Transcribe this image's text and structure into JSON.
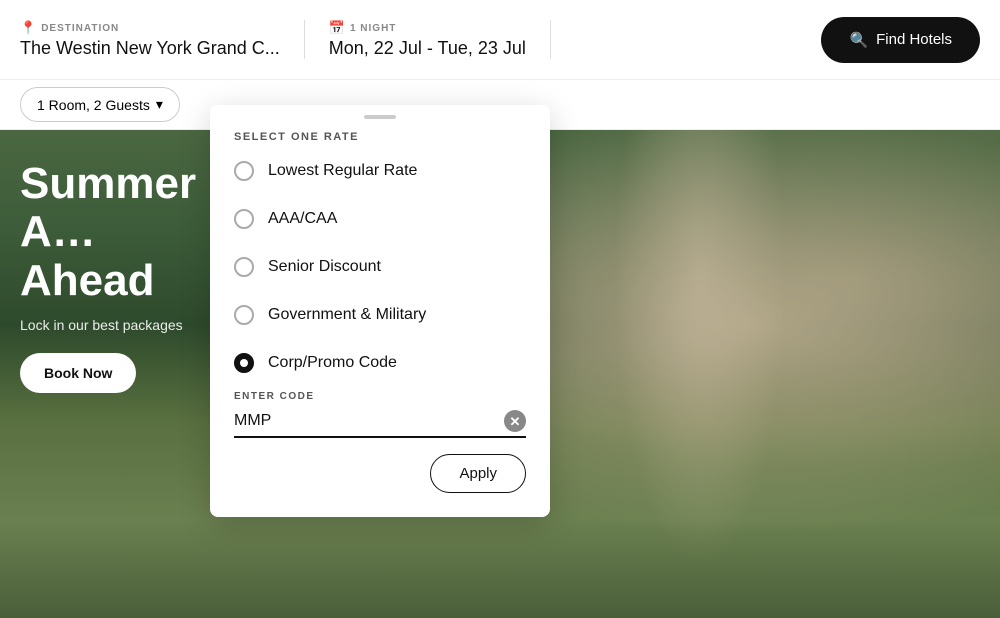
{
  "header": {
    "destination_label": "DESTINATION",
    "destination_value": "The Westin New York Grand C...",
    "nights_label": "1 NIGHT",
    "nights_value": "Mon, 22 Jul - Tue, 23 Jul",
    "find_hotels_label": "Find Hotels"
  },
  "subheader": {
    "rooms_guests_label": "1 Room, 2 Guests"
  },
  "hero": {
    "title": "Summer A… Ahead",
    "subtitle": "Lock in our best packages",
    "book_now_label": "Book Now"
  },
  "rate_dropdown": {
    "section_label": "SELECT ONE RATE",
    "options": [
      {
        "id": "lowest",
        "label": "Lowest Regular Rate",
        "selected": false
      },
      {
        "id": "aaa",
        "label": "AAA/CAA",
        "selected": false
      },
      {
        "id": "senior",
        "label": "Senior Discount",
        "selected": false
      },
      {
        "id": "gov",
        "label": "Government & Military",
        "selected": false
      },
      {
        "id": "corp",
        "label": "Corp/Promo Code",
        "selected": true
      }
    ],
    "code_entry_label": "ENTER CODE",
    "code_value": "MMP",
    "apply_label": "Apply"
  }
}
